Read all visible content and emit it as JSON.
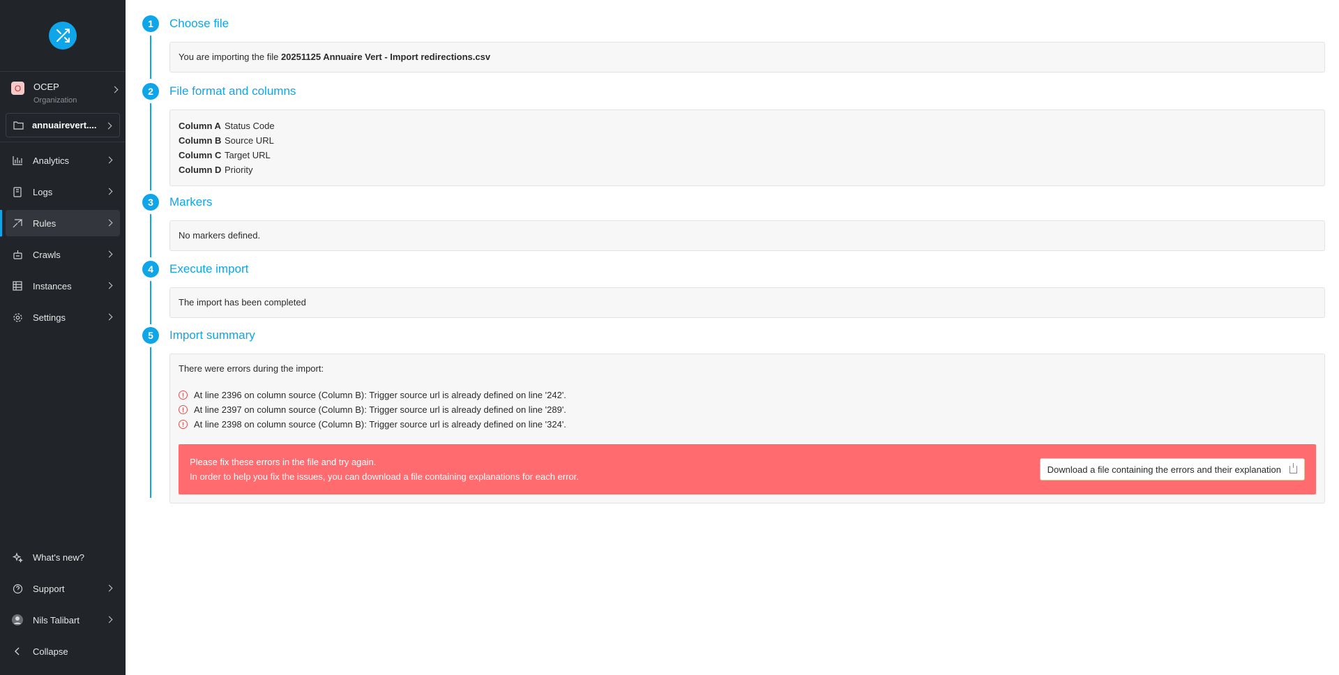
{
  "sidebar": {
    "org": {
      "initial": "O",
      "name": "OCEP",
      "sub": "Organization"
    },
    "project": {
      "name": "annuairevert...."
    },
    "nav": [
      {
        "label": "Analytics",
        "icon": "analytics-icon"
      },
      {
        "label": "Logs",
        "icon": "logs-icon"
      },
      {
        "label": "Rules",
        "icon": "rules-icon"
      },
      {
        "label": "Crawls",
        "icon": "crawls-icon"
      },
      {
        "label": "Instances",
        "icon": "instances-icon"
      },
      {
        "label": "Settings",
        "icon": "gear-icon"
      }
    ],
    "bottom": [
      {
        "label": "What's new?",
        "icon": "sparkle-icon"
      },
      {
        "label": "Support",
        "icon": "help-icon"
      },
      {
        "label": "Nils Talibart",
        "icon": "avatar"
      },
      {
        "label": "Collapse",
        "icon": "chevron-left-icon"
      }
    ]
  },
  "steps": [
    {
      "num": "1",
      "title": "Choose file",
      "prefix": "You are importing the file ",
      "file": "20251125 Annuaire Vert - Import redirections.csv"
    },
    {
      "num": "2",
      "title": "File format and columns",
      "columns": [
        {
          "key": "Column A",
          "value": "Status Code"
        },
        {
          "key": "Column B",
          "value": "Source URL"
        },
        {
          "key": "Column C",
          "value": "Target URL"
        },
        {
          "key": "Column D",
          "value": "Priority"
        }
      ]
    },
    {
      "num": "3",
      "title": "Markers",
      "text": "No markers defined."
    },
    {
      "num": "4",
      "title": "Execute import",
      "text": "The import has been completed"
    },
    {
      "num": "5",
      "title": "Import summary",
      "intro": "There were errors during the import:",
      "errors": [
        "At line 2396 on column source (Column B): Trigger source url is already defined on line '242'.",
        "At line 2397 on column source (Column B): Trigger source url is already defined on line '289'.",
        "At line 2398 on column source (Column B): Trigger source url is already defined on line '324'."
      ],
      "alert_line1": "Please fix these errors in the file and try again.",
      "alert_line2": "In order to help you fix the issues, you can download a file containing explanations for each error.",
      "download_label": "Download a file containing the errors and their explanation"
    }
  ],
  "colors": {
    "accent": "#0ea5e9",
    "sidebar_bg": "#212428",
    "alert_bg": "#ff6b6e"
  }
}
